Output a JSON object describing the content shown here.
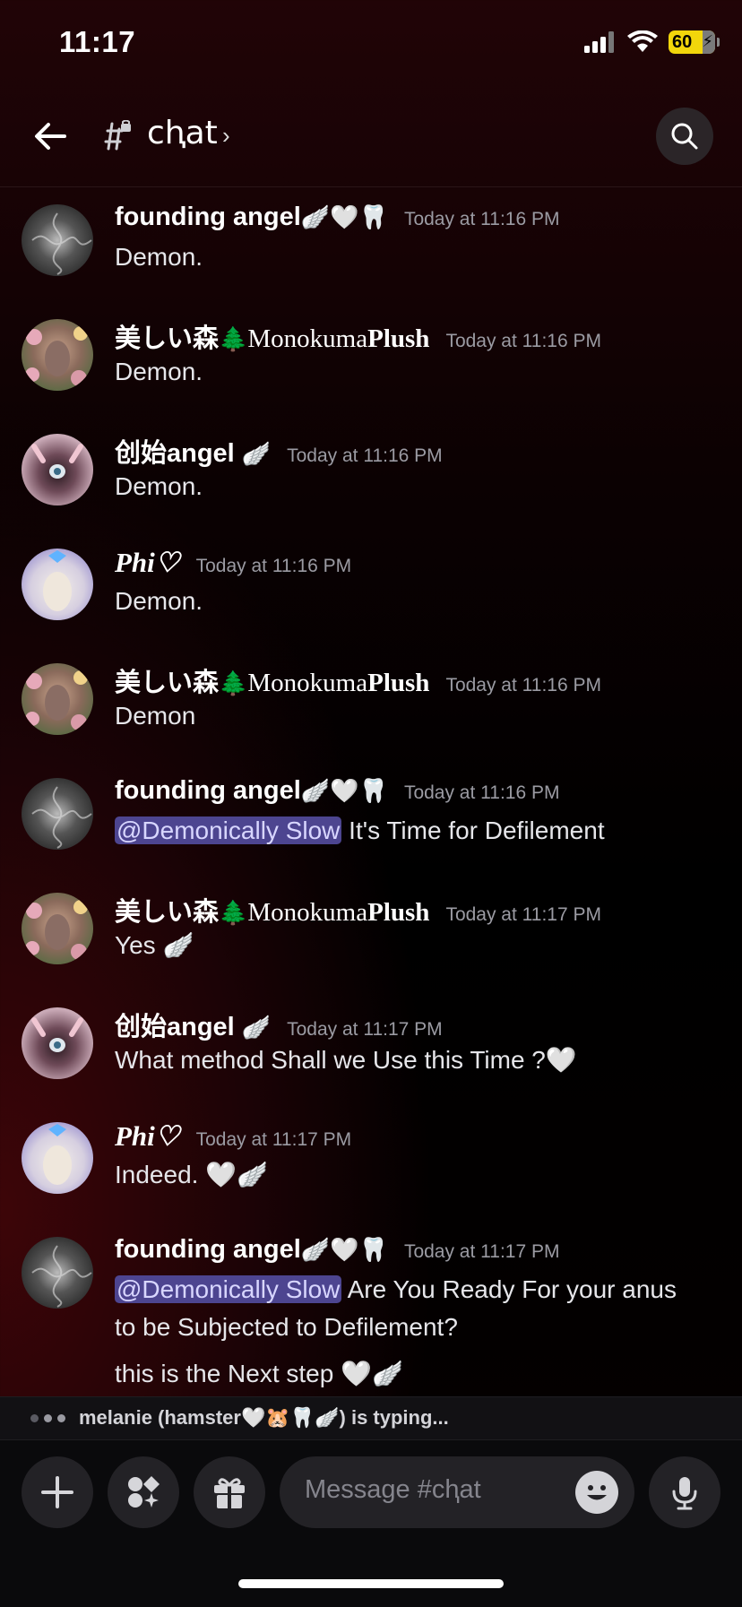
{
  "status_bar": {
    "time": "11:17",
    "battery": "60",
    "icons": [
      "signal-icon",
      "wifi-icon",
      "battery-icon"
    ]
  },
  "header": {
    "channel_name": "chat",
    "channel_display": "cⱨat",
    "chevron": "›",
    "icons": [
      "back-arrow-icon",
      "locked-channel-icon",
      "search-icon"
    ]
  },
  "messages": [
    {
      "author": "founding angel",
      "author_emoji": "🪽🤍🦷",
      "time": "Today at 11:16 PM",
      "lines": [
        "Demon."
      ],
      "avatar_color": "#6b6b6b"
    },
    {
      "author": "美しい森",
      "author_emoji": "🌲",
      "author_suffix": "Monokuma",
      "author_bold": "Plush",
      "time": "Today at 11:16 PM",
      "lines": [
        "Demon."
      ],
      "avatar_color": "#a57d66"
    },
    {
      "author": "创始angel",
      "author_emoji": "🪽",
      "time": "Today at 11:16 PM",
      "lines": [
        "Demon."
      ],
      "avatar_color": "#8d6a78"
    },
    {
      "author": "Phi♡",
      "time": "Today at 11:16 PM",
      "lines": [
        "Demon."
      ],
      "avatar_color": "#d8d2e2"
    },
    {
      "author": "美しい森",
      "author_emoji": "🌲",
      "author_suffix": "Monokuma",
      "author_bold": "Plush",
      "time": "Today at 11:16 PM",
      "lines": [
        "Demon"
      ],
      "avatar_color": "#a57d66"
    },
    {
      "author": "founding angel",
      "author_emoji": "🪽🤍🦷",
      "time": "Today at 11:16 PM",
      "mention": "@Demonically Slow",
      "lines": [
        "It's Time for Defilement"
      ],
      "avatar_color": "#6b6b6b"
    },
    {
      "author": "美しい森",
      "author_emoji": "🌲",
      "author_suffix": "Monokuma",
      "author_bold": "Plush",
      "time": "Today at 11:17 PM",
      "lines": [
        "Yes 🪽"
      ],
      "avatar_color": "#a57d66"
    },
    {
      "author": "创始angel",
      "author_emoji": "🪽",
      "time": "Today at 11:17 PM",
      "lines": [
        "What method Shall we Use this Time ?🤍"
      ],
      "avatar_color": "#8d6a78"
    },
    {
      "author": "Phi♡",
      "time": "Today at 11:17 PM",
      "lines": [
        "Indeed. 🤍🪽"
      ],
      "avatar_color": "#d8d2e2"
    },
    {
      "author": "founding angel",
      "author_emoji": "🪽🤍🦷",
      "time": "Today at 11:17 PM",
      "mention": "@Demonically Slow",
      "lines": [
        "Are You Ready For your anus",
        "to be Subjected to Defilement?",
        "this is the Next step 🤍🪽"
      ],
      "avatar_color": "#6b6b6b"
    }
  ],
  "typing": {
    "text": "melanie (hamster🤍🐹🦷🪽) is typing..."
  },
  "composer": {
    "placeholder": "Message #cⱨat",
    "buttons": [
      "plus-icon",
      "apps-icon",
      "gift-icon",
      "emoji-icon",
      "microphone-icon"
    ]
  }
}
